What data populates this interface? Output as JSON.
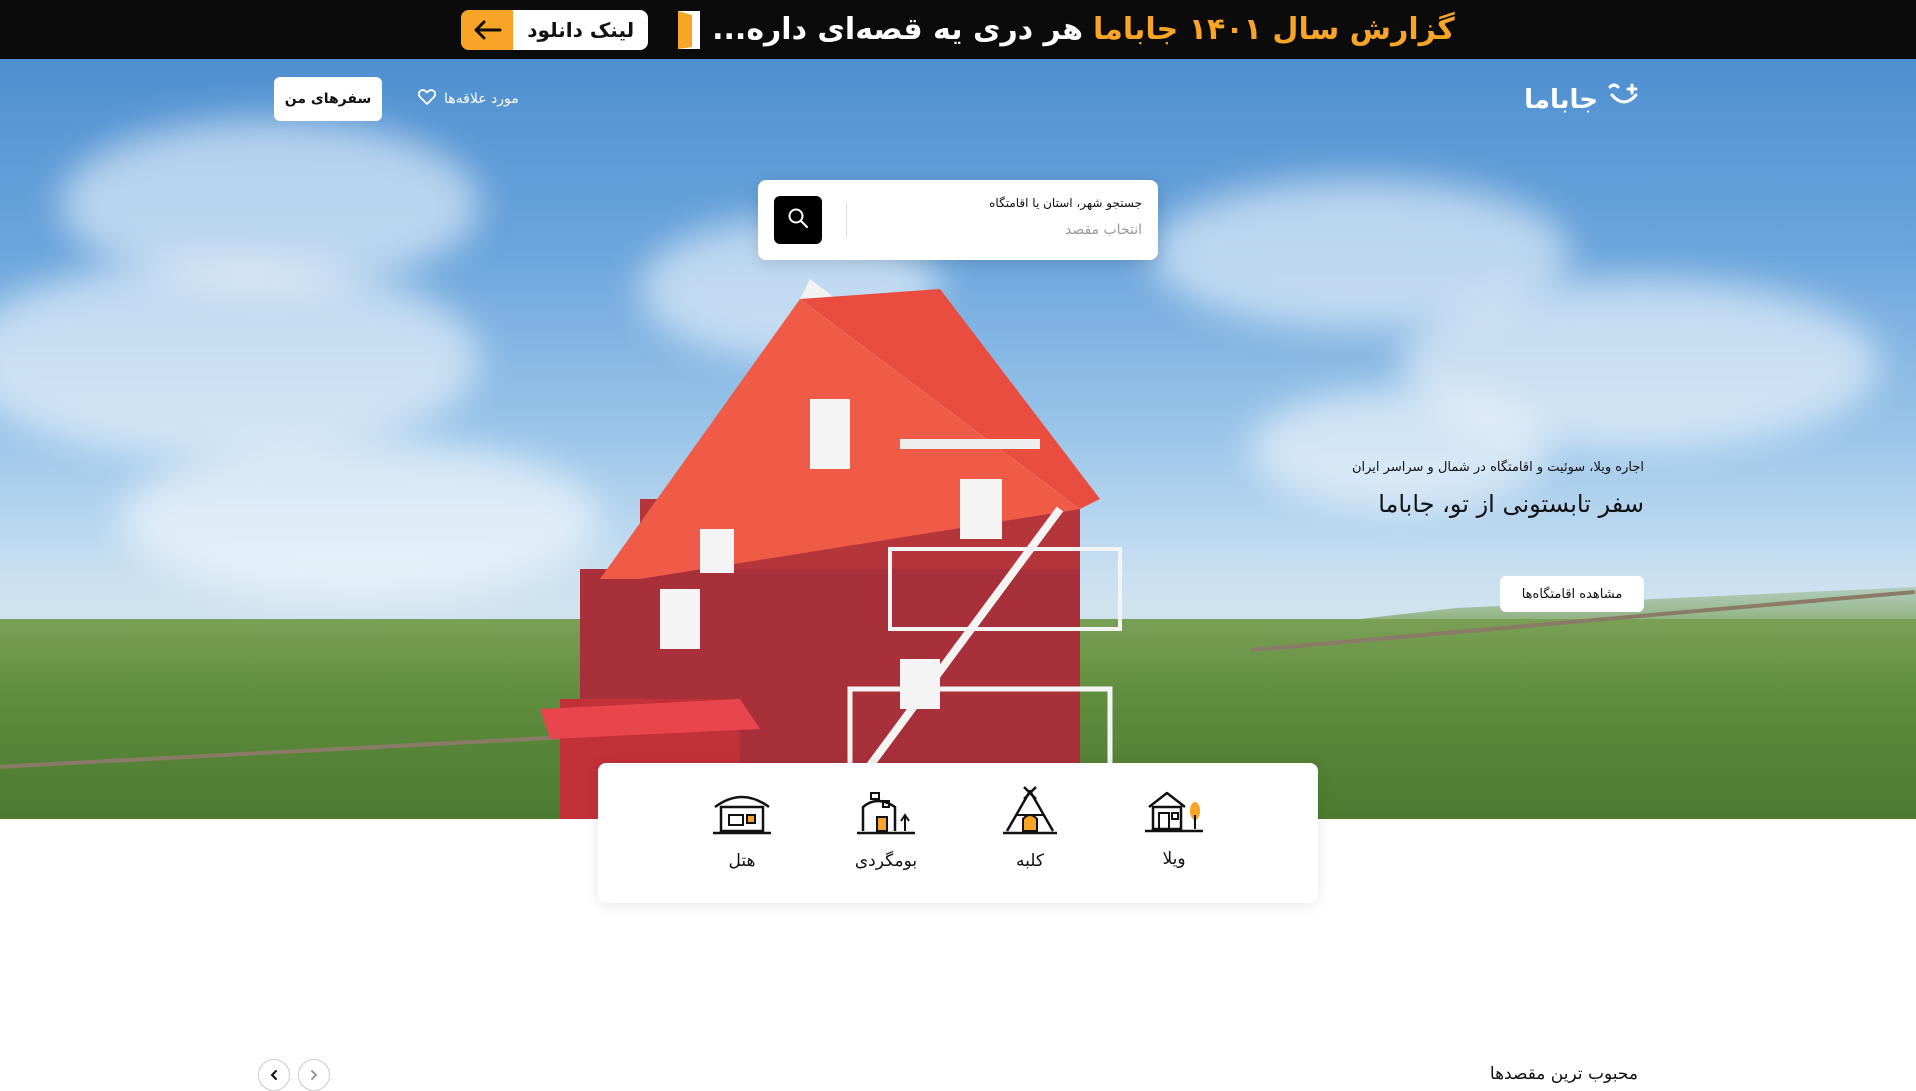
{
  "promo": {
    "download_label": "لینک دانلود",
    "text_white": "هر دری یه قصه‌ای داره...",
    "text_accent": "گزارش سال ۱۴۰۱ جاباما",
    "accent_color": "#f7a427"
  },
  "nav": {
    "logo_text": "جاباما",
    "trips_label": "سفرهای من",
    "favorites_label": "مورد علاقه‌ها"
  },
  "search": {
    "label": "جستجو شهر، استان یا اقامتگاه",
    "placeholder": "انتخاب مقصد"
  },
  "hero": {
    "subtitle": "اجاره ویلا، سوئیت و اقامتگاه در شمال و سراسر ایران",
    "title": "سفر تابستونی از تو، جاباما",
    "cta_label": "مشاهده اقامتگاه‌ها"
  },
  "categories": [
    {
      "label": "ویلا",
      "icon": "villa-icon"
    },
    {
      "label": "کلبه",
      "icon": "cabin-icon"
    },
    {
      "label": "بومگردی",
      "icon": "ecolodge-icon"
    },
    {
      "label": "هتل",
      "icon": "hotel-icon"
    }
  ],
  "popular": {
    "title": "محبوب ترین مقصدها"
  }
}
